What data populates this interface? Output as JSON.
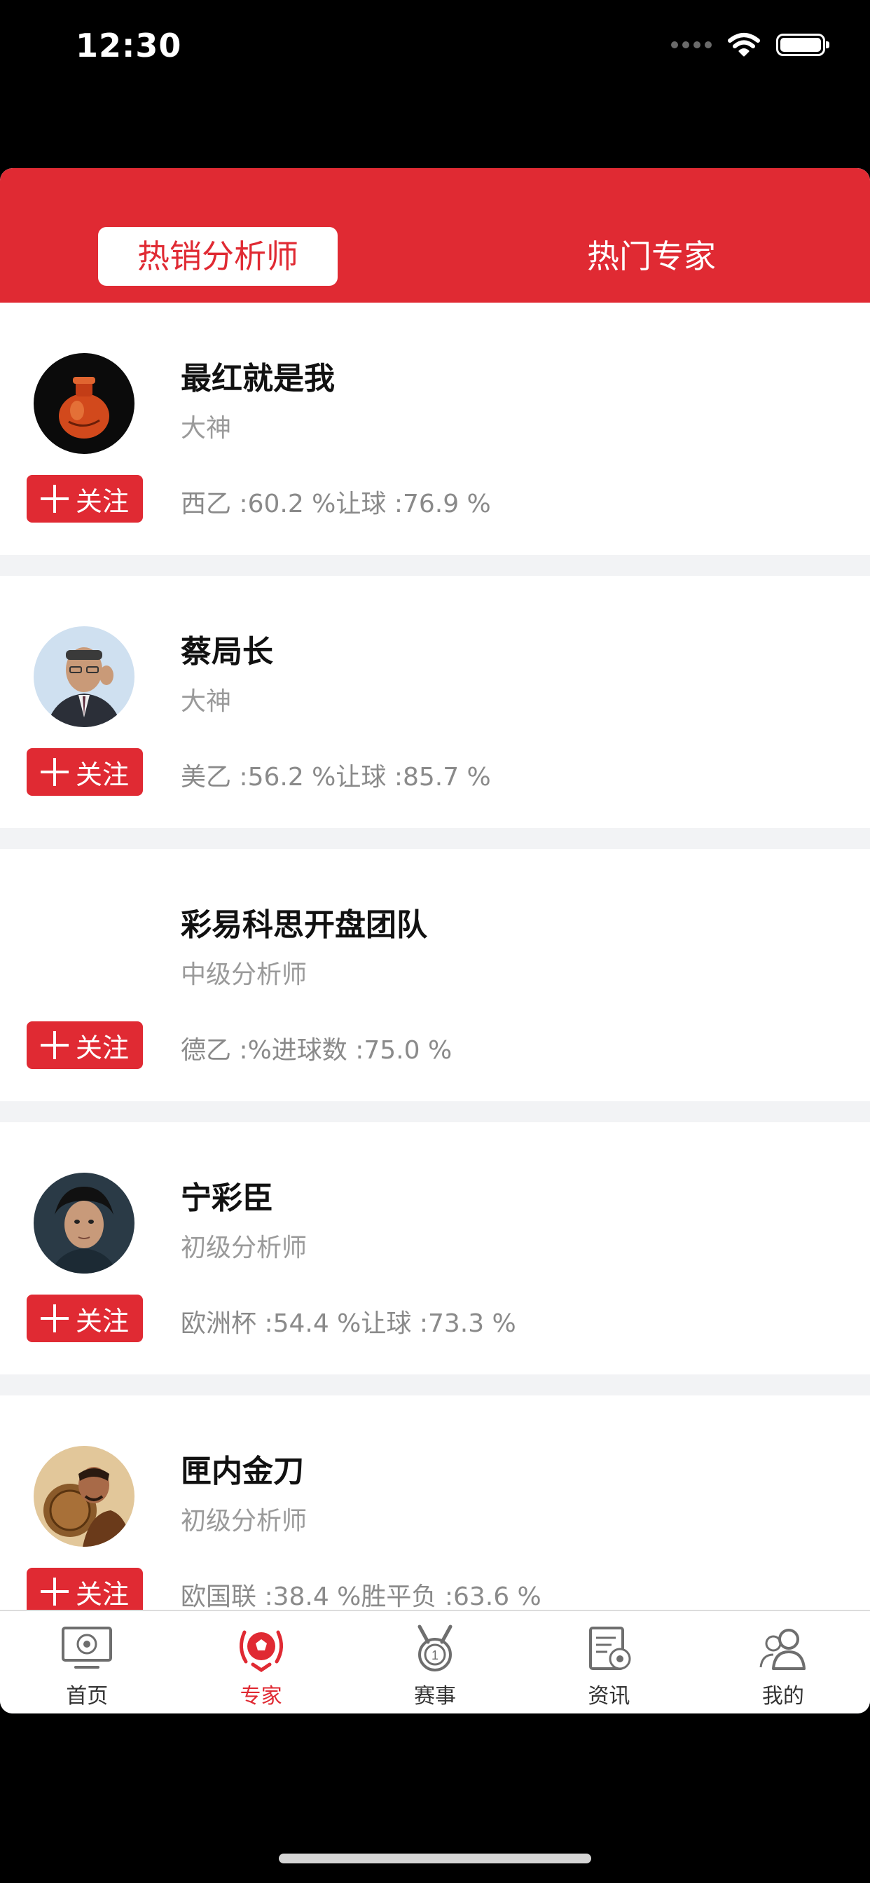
{
  "status_bar": {
    "time": "12:30"
  },
  "tabs": [
    {
      "label": "热销分析师",
      "active": true
    },
    {
      "label": "热门专家",
      "active": false
    }
  ],
  "experts": [
    {
      "name": "最红就是我",
      "level": "大神",
      "stats": "西乙 :60.2 %让球 :76.9 %",
      "follow_label": "关注",
      "avatar": "snuff-bottle-avatar"
    },
    {
      "name": "蔡局长",
      "level": "大神",
      "stats": "美乙 :56.2 %让球 :85.7 %",
      "follow_label": "关注",
      "avatar": "man-in-suit-avatar"
    },
    {
      "name": "彩易科思开盘团队",
      "level": "中级分析师",
      "stats": "德乙 :%进球数 :75.0 %",
      "follow_label": "关注",
      "avatar": ""
    },
    {
      "name": "宁彩臣",
      "level": "初级分析师",
      "stats": "欧洲杯 :54.4 %让球 :73.3 %",
      "follow_label": "关注",
      "avatar": "actor-avatar"
    },
    {
      "name": "匣内金刀",
      "level": "初级分析师",
      "stats": "欧国联 :38.4 %胜平负 :63.6 %",
      "follow_label": "关注",
      "avatar": "warrior-avatar"
    }
  ],
  "bottom_nav": [
    {
      "label": "首页",
      "icon": "tv-football-icon",
      "active": false
    },
    {
      "label": "专家",
      "icon": "football-laurel-icon",
      "active": true
    },
    {
      "label": "赛事",
      "icon": "medal-icon",
      "active": false
    },
    {
      "label": "资讯",
      "icon": "news-football-icon",
      "active": false
    },
    {
      "label": "我的",
      "icon": "users-icon",
      "active": false
    }
  ],
  "colors": {
    "brand_red": "#e02a33",
    "muted_text": "#9a9a9a"
  }
}
